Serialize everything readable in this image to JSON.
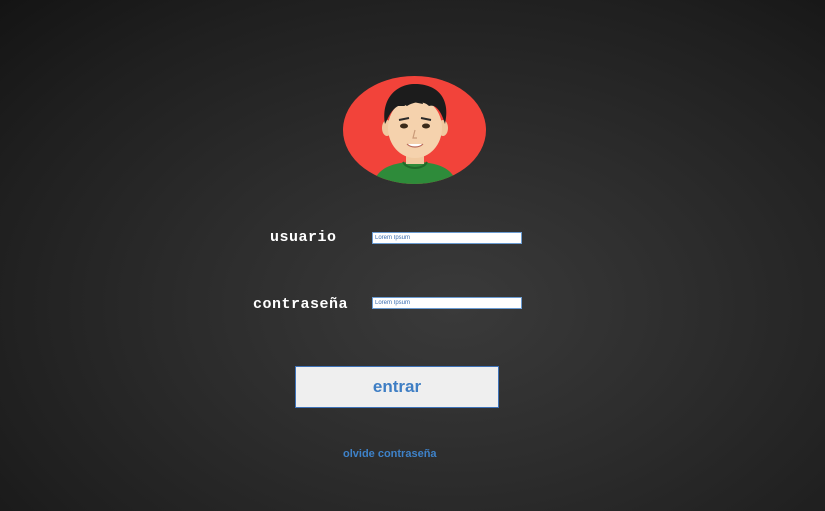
{
  "avatar": {
    "icon": "user-avatar-icon",
    "background": "#f2433a"
  },
  "login": {
    "username_label": "usuario",
    "username_value": "Lorem Ipsum",
    "password_label": "contraseña",
    "password_value": "Lorem Ipsum",
    "submit_label": "entrar",
    "forgot_label": "olvide contraseña"
  },
  "colors": {
    "accent": "#3e7ec4",
    "background": "#2a2a2a"
  }
}
